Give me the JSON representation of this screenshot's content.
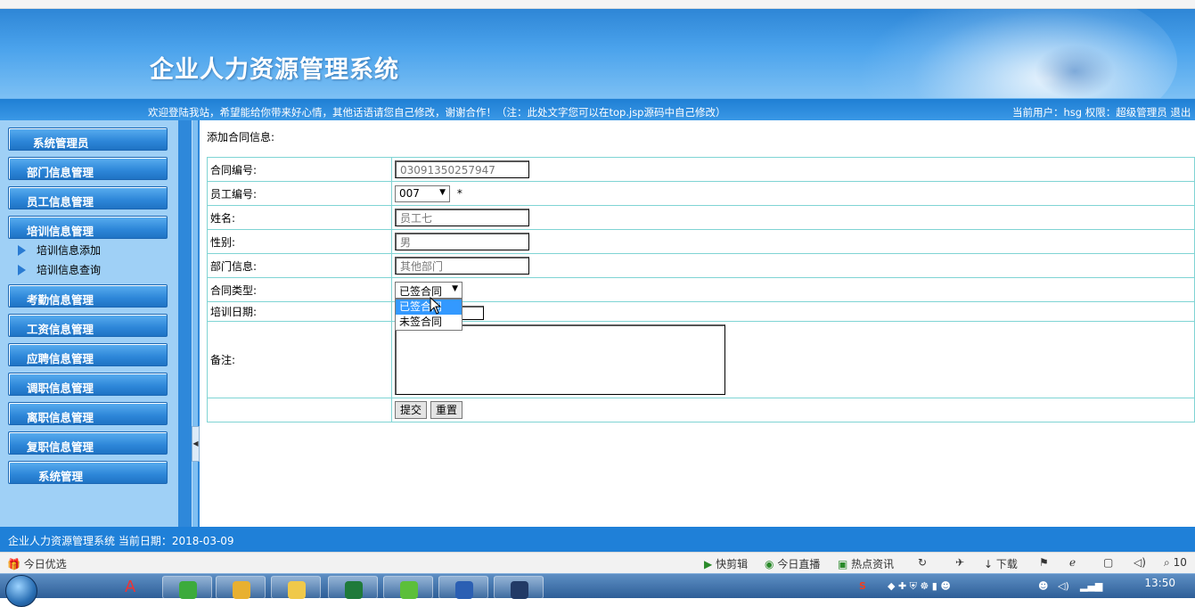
{
  "app": {
    "title": "企业人力资源管理系统",
    "marquee": "欢迎登陆我站，希望能给你带来好心情，其他话语请您自己修改，谢谢合作！（注：此处文字您可以在top.jsp源码中自己修改）",
    "user_info": "当前用户：hsg 权限：超级管理员 退出"
  },
  "sidebar": {
    "menus": [
      {
        "label": "系统管理员"
      },
      {
        "label": "部门信息管理"
      },
      {
        "label": "员工信息管理"
      },
      {
        "label": "培训信息管理"
      },
      {
        "label": "考勤信息管理"
      },
      {
        "label": "工资信息管理"
      },
      {
        "label": "应聘信息管理"
      },
      {
        "label": "调职信息管理"
      },
      {
        "label": "离职信息管理"
      },
      {
        "label": "复职信息管理"
      },
      {
        "label": "系统管理"
      }
    ],
    "submenu": [
      {
        "label": "培训信息添加"
      },
      {
        "label": "培训信息查询"
      }
    ]
  },
  "form": {
    "heading": "添加合同信息:",
    "fields": {
      "contract_no": {
        "label": "合同编号:",
        "value": "03091350257947"
      },
      "employee_no": {
        "label": "员工编号:",
        "value": "007",
        "required": "*"
      },
      "name": {
        "label": "姓名:",
        "value": "员工七"
      },
      "gender": {
        "label": "性别:",
        "value": "男"
      },
      "department": {
        "label": "部门信息:",
        "value": "其他部门"
      },
      "contract_type": {
        "label": "合同类型:",
        "value": "已签合同",
        "options": [
          "已签合同",
          "未签合同"
        ]
      },
      "training_date": {
        "label": "培训日期:",
        "value": ""
      },
      "remark": {
        "label": "备注:",
        "value": ""
      }
    },
    "buttons": {
      "submit": "提交",
      "reset": "重置"
    }
  },
  "status": {
    "text": "企业人力资源管理系统 当前日期：2018-03-09"
  },
  "browser_bar": {
    "left": "今日优选",
    "items": [
      "快剪辑",
      "今日直播",
      "热点资讯",
      "下载",
      "10"
    ]
  },
  "taskbar": {
    "time": "13:50"
  },
  "colors": {
    "banner": "#2e86d6",
    "sidebar": "#9fd0f6",
    "menu_button": "#2d86d8",
    "table_border": "#7fd4d4",
    "status_bar": "#1f80d8"
  }
}
